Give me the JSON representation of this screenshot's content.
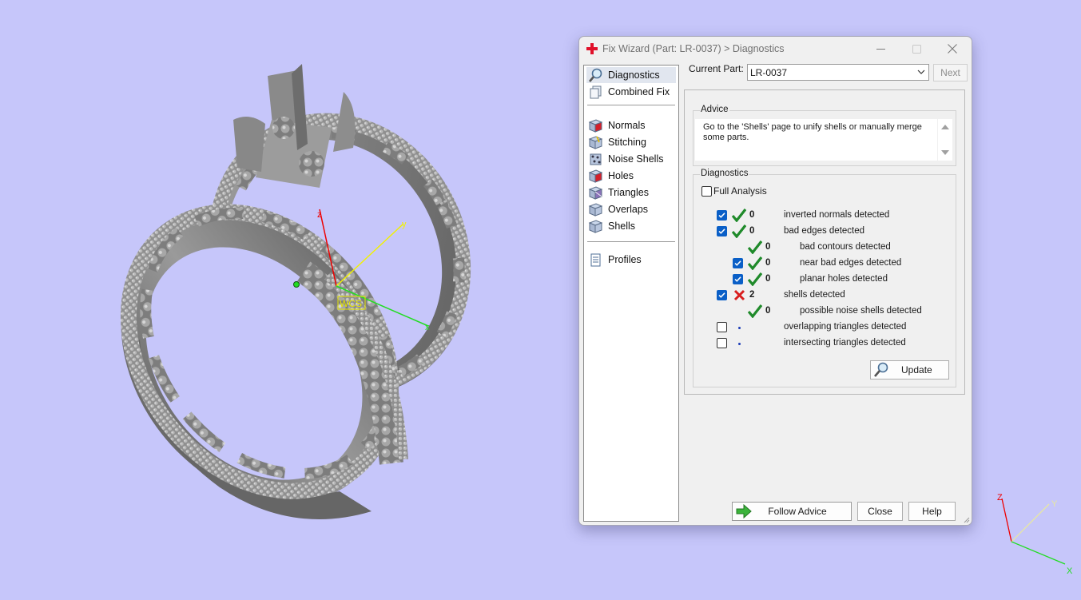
{
  "window": {
    "title": "Fix Wizard (Part: LR-0037) > Diagnostics",
    "app_icon": "red-cross-icon",
    "controls": [
      "minimize-icon",
      "maximize-icon",
      "close-icon"
    ]
  },
  "nav": {
    "items": [
      {
        "label": "Diagnostics",
        "icon": "magnifier-icon",
        "selected": true
      },
      {
        "label": "Combined Fix",
        "icon": "combined-fix-icon"
      },
      {
        "label": "Normals",
        "icon": "normals-cube-icon"
      },
      {
        "label": "Stitching",
        "icon": "stitching-cube-icon"
      },
      {
        "label": "Noise Shells",
        "icon": "noise-shells-icon"
      },
      {
        "label": "Holes",
        "icon": "holes-cube-icon"
      },
      {
        "label": "Triangles",
        "icon": "triangles-cube-icon"
      },
      {
        "label": "Overlaps",
        "icon": "overlaps-cube-icon"
      },
      {
        "label": "Shells",
        "icon": "shells-cube-icon"
      },
      {
        "label": "Profiles",
        "icon": "document-icon"
      }
    ]
  },
  "header": {
    "current_part_label": "Current Part:",
    "current_part_value": "LR-0037",
    "next_label": "Next"
  },
  "advice": {
    "title": "Advice",
    "text": "Go to the 'Shells' page to unify shells or manually merge some parts."
  },
  "diagnostics": {
    "title": "Diagnostics",
    "full_analysis_label": "Full Analysis",
    "full_analysis_checked": false,
    "rows": [
      {
        "checked": true,
        "status": "ok",
        "count": "0",
        "label": "inverted normals detected",
        "indent": 0
      },
      {
        "checked": true,
        "status": "ok",
        "count": "0",
        "label": "bad edges detected",
        "indent": 0
      },
      {
        "checked": null,
        "status": "ok",
        "count": "0",
        "label": "bad contours detected",
        "indent": 1
      },
      {
        "checked": true,
        "status": "ok",
        "count": "0",
        "label": "near bad edges detected",
        "indent": 1
      },
      {
        "checked": true,
        "status": "ok",
        "count": "0",
        "label": "planar holes detected",
        "indent": 1
      },
      {
        "checked": true,
        "status": "error",
        "count": "2",
        "label": "shells detected",
        "indent": 0
      },
      {
        "checked": null,
        "status": "ok",
        "count": "0",
        "label": "possible noise shells detected",
        "indent": 1
      },
      {
        "checked": false,
        "status": "pending",
        "count": "",
        "label": "overlapping triangles detected",
        "indent": 0
      },
      {
        "checked": false,
        "status": "pending",
        "count": "",
        "label": "intersecting triangles detected",
        "indent": 0
      }
    ],
    "update_label": "Update"
  },
  "footer": {
    "follow_advice_label": "Follow Advice",
    "close_label": "Close",
    "help_label": "Help"
  },
  "viewport": {
    "background": "#c6c6fa",
    "wcs_label": "WCS",
    "axes": {
      "x": "x",
      "y": "y",
      "z": "z"
    },
    "triad": {
      "x": "X",
      "y": "Y",
      "z": "Z"
    },
    "colors": {
      "x": "#22dd22",
      "y": "#f2f200",
      "z": "#ee0000"
    }
  }
}
